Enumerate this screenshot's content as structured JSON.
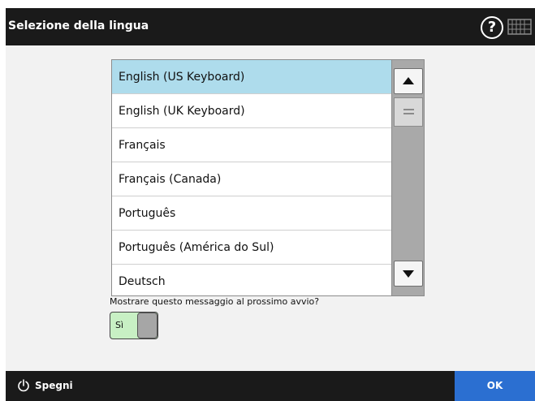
{
  "header": {
    "title": "Selezione della lingua",
    "help_label": "?",
    "keyboard_icon": "keyboard-icon"
  },
  "language_list": {
    "items": [
      {
        "label": "English (US Keyboard)",
        "selected": true
      },
      {
        "label": "English (UK Keyboard)",
        "selected": false
      },
      {
        "label": "Français",
        "selected": false
      },
      {
        "label": "Français (Canada)",
        "selected": false
      },
      {
        "label": "Português",
        "selected": false
      },
      {
        "label": "Português (América do Sul)",
        "selected": false
      },
      {
        "label": "Deutsch",
        "selected": false
      }
    ]
  },
  "startup_prompt": {
    "question": "Mostrare questo messaggio al prossimo avvio?",
    "toggle_label": "Sì",
    "toggle_on": true
  },
  "footer": {
    "power_label": "Spegni",
    "ok_label": "OK"
  },
  "colors": {
    "selected_row": "#aedcec",
    "ok_button": "#2b6fd1",
    "toggle_on": "#c8f0c4",
    "bar": "#1a1a1a"
  }
}
